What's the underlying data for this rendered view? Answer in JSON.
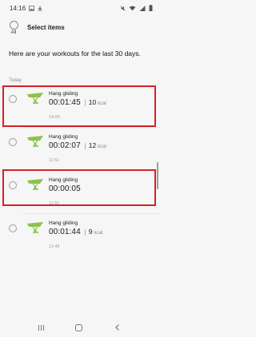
{
  "status_bar": {
    "time": "14:16",
    "left_icons": [
      "image-notification-icon",
      "download-icon"
    ],
    "right_icons": [
      "mute-icon",
      "wifi-icon",
      "signal-icon",
      "battery-icon"
    ]
  },
  "header": {
    "all_label": "All",
    "title": "Select items"
  },
  "intro_text": "Here are your workouts for the last 30 days.",
  "section_label": "Today",
  "colors": {
    "accent": "#8bc34a",
    "highlight": "#d4202a"
  },
  "workouts": [
    {
      "name": "Hang gliding",
      "duration": "00:01:45",
      "calories": "10",
      "cal_unit": "kcal",
      "time": "14:06",
      "icon": "hang-glider-icon",
      "selected": false
    },
    {
      "name": "Hang gliding",
      "duration": "00:02:07",
      "calories": "12",
      "cal_unit": "kcal",
      "time": "11:51",
      "icon": "hang-glider-icon",
      "selected": false
    },
    {
      "name": "Hang gliding",
      "duration": "00:00:05",
      "calories": "",
      "cal_unit": "",
      "time": "11:51",
      "icon": "hang-glider-icon",
      "selected": false
    },
    {
      "name": "Hang gliding",
      "duration": "00:01:44",
      "calories": "9",
      "cal_unit": "kcal",
      "time": "11:43",
      "icon": "hang-glider-icon",
      "selected": false
    }
  ],
  "nav_bar": {
    "icons": [
      "recents-icon",
      "home-icon",
      "back-icon"
    ]
  }
}
